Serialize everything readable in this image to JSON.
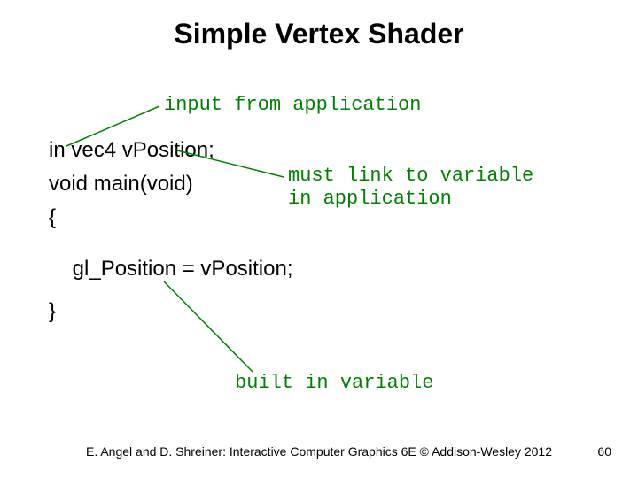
{
  "title": "Simple Vertex Shader",
  "annotations": {
    "top": "input from application",
    "right_line1": "must link to variable",
    "right_line2": "in application",
    "bottom": "built in variable"
  },
  "code": {
    "line1": "in vec4 vPosition;",
    "line2": "void main(void)",
    "line3": "{",
    "line4": "    gl_Position = vPosition;",
    "line5": "}"
  },
  "footer": "E. Angel and D. Shreiner: Interactive Computer Graphics 6E © Addison-Wesley 2012",
  "page_number": "60"
}
